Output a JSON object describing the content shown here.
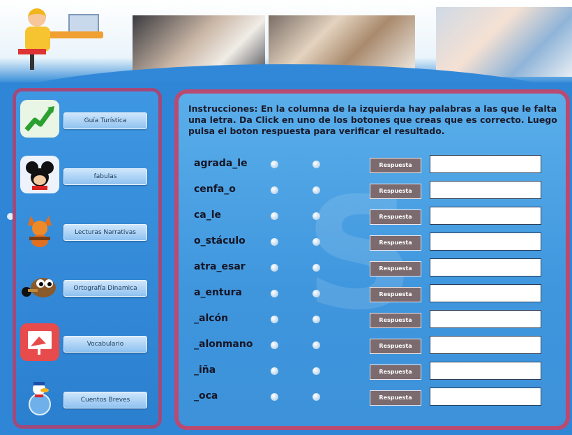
{
  "sidebar": {
    "items": [
      {
        "label": "Guía Turística",
        "icon": "trend-chart-icon",
        "color": "#e9f5e5"
      },
      {
        "label": "fabulas",
        "icon": "cartoon-mouse-icon",
        "color": "#eef3fb"
      },
      {
        "label": "Lecturas Narrativas",
        "icon": "cartoon-fox-icon",
        "color": "#3e97e2"
      },
      {
        "label": "Ortografía Dinamica",
        "icon": "gimp-mascot-icon",
        "color": "#3e97e2"
      },
      {
        "label": "Vocabulario",
        "icon": "presentation-icon",
        "color": "#e84b4b"
      },
      {
        "label": "Cuentos Breves",
        "icon": "cartoon-duck-icon",
        "color": "#3e97e2"
      }
    ]
  },
  "main": {
    "instructions": "Instrucciones: En la columna de la izquierda hay palabras a las que le falta una letra. Da Click en uno de los botones que creas que es correcto. Luego pulsa el boton respuesta para verificar el resultado.",
    "respuesta_label": "Respuesta",
    "rows": [
      {
        "word": "agrada_le",
        "answer": ""
      },
      {
        "word": "cenfa_o",
        "answer": ""
      },
      {
        "word": "ca_le",
        "answer": ""
      },
      {
        "word": "o_stáculo",
        "answer": ""
      },
      {
        "word": "atra_esar",
        "answer": ""
      },
      {
        "word": "a_entura",
        "answer": ""
      },
      {
        "word": "_alcón",
        "answer": ""
      },
      {
        "word": "_alonmano",
        "answer": ""
      },
      {
        "word": "_iña",
        "answer": ""
      },
      {
        "word": "_oca",
        "answer": ""
      }
    ]
  },
  "colors": {
    "background": "#2f86d6",
    "frame_border": "#b94a72",
    "respuesta_button": "#7b6a6e"
  }
}
